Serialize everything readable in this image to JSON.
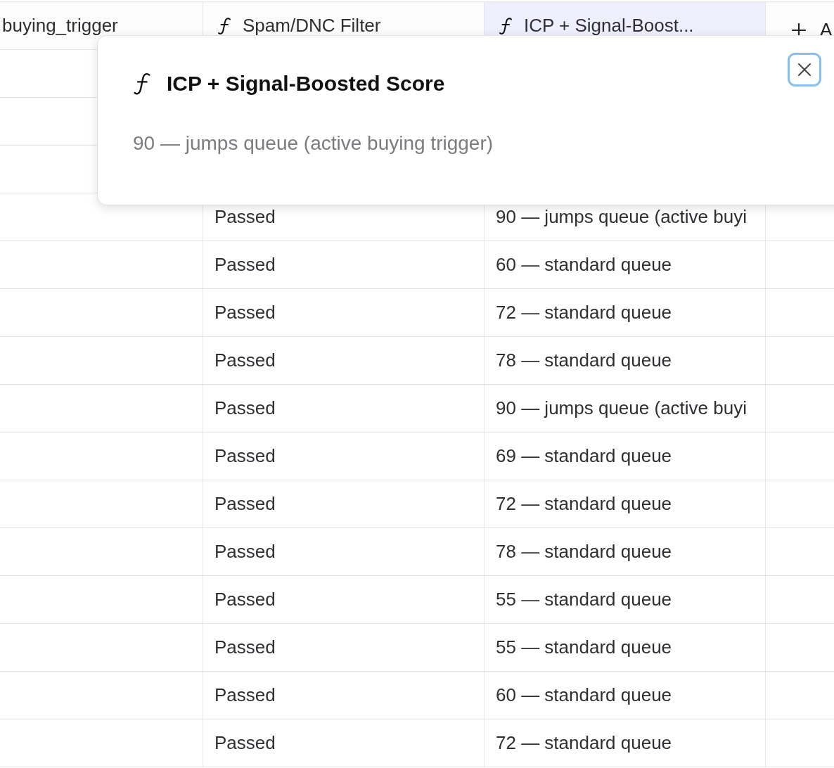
{
  "table": {
    "columns": [
      {
        "label": "buying_trigger",
        "kind": "text",
        "selected": false
      },
      {
        "label": "Spam/DNC Filter",
        "kind": "formula",
        "selected": false
      },
      {
        "label": "ICP + Signal-Boost...",
        "kind": "formula",
        "selected": true
      }
    ],
    "add_column": {
      "label": "A"
    },
    "rows": [
      {
        "filter": "Passed",
        "score": "90 — jumps queue (active buyi"
      },
      {
        "filter": "Passed",
        "score": "60 — standard queue"
      },
      {
        "filter": "Passed",
        "score": "72 — standard queue"
      },
      {
        "filter": "Passed",
        "score": "78 — standard queue"
      },
      {
        "filter": "Passed",
        "score": "90 — jumps queue (active buyi"
      },
      {
        "filter": "Passed",
        "score": "69 — standard queue"
      },
      {
        "filter": "Passed",
        "score": "72 — standard queue"
      },
      {
        "filter": "Passed",
        "score": "78 — standard queue"
      },
      {
        "filter": "Passed",
        "score": "55 — standard queue"
      },
      {
        "filter": "Passed",
        "score": "55 — standard queue"
      },
      {
        "filter": "Passed",
        "score": "60 — standard queue"
      },
      {
        "filter": "Passed",
        "score": "72 — standard queue"
      }
    ]
  },
  "popup": {
    "kind": "formula",
    "title": "ICP + Signal-Boosted Score",
    "value": "90 — jumps queue (active buying trigger)"
  }
}
